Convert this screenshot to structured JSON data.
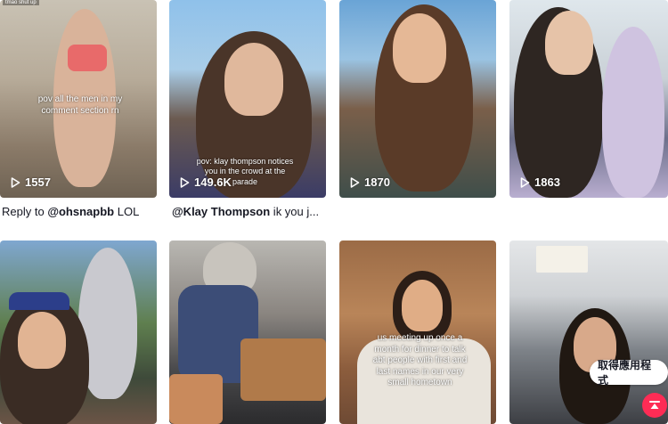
{
  "videos": [
    {
      "views": "1557",
      "top_tag": "tmao shut up",
      "overlay": "pov all the men in my\ncomment section rn"
    },
    {
      "views": "149.6K",
      "overlay": "pov: klay thompson notices\nyou in the crowd at the\nparade"
    },
    {
      "views": "1870"
    },
    {
      "views": "1863"
    },
    {},
    {},
    {
      "overlay": "us meeting up once a\nmonth for dinner to talk\nabt people with first and\nlast names in our very\nsmall hometown"
    },
    {}
  ],
  "descriptions": [
    {
      "prefix": "Reply to ",
      "mention": "@ohsnapbb",
      "suffix": " LOL"
    },
    {
      "mention": "@Klay Thompson",
      "suffix": " ik you j..."
    }
  ],
  "get_app_label": "取得應用程式",
  "icons": {
    "play": "play-icon",
    "back_to_top": "arrow-up-icon"
  },
  "colors": {
    "accent": "#fe2c55",
    "text": "#161823"
  }
}
